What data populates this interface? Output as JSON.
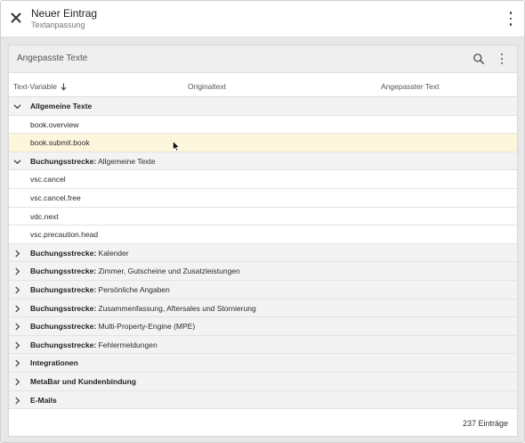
{
  "topbar": {
    "title": "Neuer Eintrag",
    "subtitle": "Textanpassung"
  },
  "card": {
    "title": "Angepasste Texte",
    "columns": [
      "Text-Variable",
      "Originaltext",
      "Angepasster Text"
    ]
  },
  "rows": [
    {
      "kind": "group",
      "expanded": true,
      "bold": "Allgemeine Texte",
      "rest": ""
    },
    {
      "kind": "leaf",
      "text": "book.overview"
    },
    {
      "kind": "leaf",
      "text": "book.submit.book",
      "highlight": true
    },
    {
      "kind": "group",
      "expanded": true,
      "bold": "Buchungsstrecke:",
      "rest": " Allgemeine Texte"
    },
    {
      "kind": "leaf",
      "text": "vsc.cancel"
    },
    {
      "kind": "leaf",
      "text": "vsc.cancel.free"
    },
    {
      "kind": "leaf",
      "text": "vdc.next"
    },
    {
      "kind": "leaf",
      "text": "vsc.precaution.head"
    },
    {
      "kind": "group",
      "expanded": false,
      "bold": "Buchungsstrecke:",
      "rest": " Kalender"
    },
    {
      "kind": "group",
      "expanded": false,
      "bold": "Buchungsstrecke:",
      "rest": " Zimmer, Gutscheine und Zusatzleistungen"
    },
    {
      "kind": "group",
      "expanded": false,
      "bold": "Buchungsstrecke:",
      "rest": " Persönliche Angaben"
    },
    {
      "kind": "group",
      "expanded": false,
      "bold": "Buchungsstrecke:",
      "rest": " Zusammenfassung, Aftersales und Stornierung"
    },
    {
      "kind": "group",
      "expanded": false,
      "bold": "Buchungsstrecke:",
      "rest": " Multi-Property-Engine (MPE)"
    },
    {
      "kind": "group",
      "expanded": false,
      "bold": "Buchungsstrecke:",
      "rest": " Fehlermeldungen"
    },
    {
      "kind": "group",
      "expanded": false,
      "bold": "Integrationen",
      "rest": ""
    },
    {
      "kind": "group",
      "expanded": false,
      "bold": "MetaBar und Kundenbindung",
      "rest": ""
    },
    {
      "kind": "group",
      "expanded": false,
      "bold": "E-Mails",
      "rest": ""
    }
  ],
  "footer": {
    "count": "237 Einträge"
  }
}
